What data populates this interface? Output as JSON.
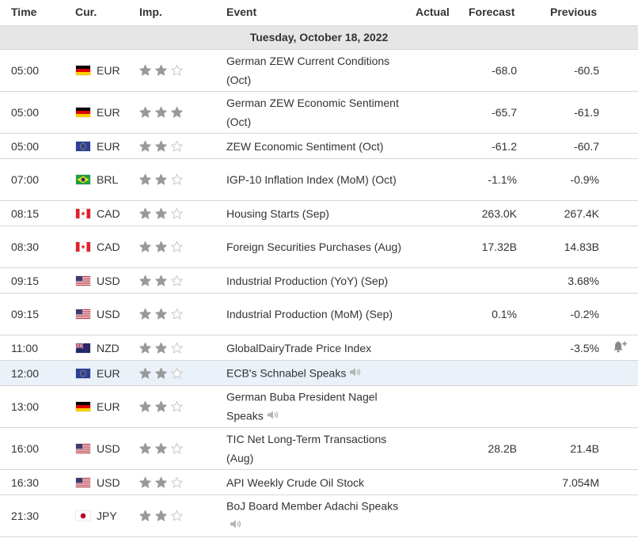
{
  "header": {
    "time": "Time",
    "currency": "Cur.",
    "importance": "Imp.",
    "event": "Event",
    "actual": "Actual",
    "forecast": "Forecast",
    "previous": "Previous"
  },
  "date_label": "Tuesday, October 18, 2022",
  "colors": {
    "star_filled": "#999999",
    "star_empty": "#cccccc",
    "border": "#d6d6d6",
    "date_row_bg": "#e6e6e6",
    "highlight_bg": "#eaf1f8"
  },
  "events": [
    {
      "time": "05:00",
      "flag": "de-flag-icon",
      "currency": "EUR",
      "stars": 2,
      "event": "German ZEW Current Conditions (Oct)",
      "speech": false,
      "actual": "",
      "forecast": "-68.0",
      "previous": "-60.5"
    },
    {
      "time": "05:00",
      "flag": "de-flag-icon",
      "currency": "EUR",
      "stars": 3,
      "event": "German ZEW Economic Sentiment (Oct)",
      "speech": false,
      "actual": "",
      "forecast": "-65.7",
      "previous": "-61.9"
    },
    {
      "time": "05:00",
      "flag": "eu-flag-icon",
      "currency": "EUR",
      "stars": 2,
      "event": "ZEW Economic Sentiment (Oct)",
      "speech": false,
      "actual": "",
      "forecast": "-61.2",
      "previous": "-60.7"
    },
    {
      "time": "07:00",
      "flag": "br-flag-icon",
      "currency": "BRL",
      "stars": 2,
      "event": "IGP-10 Inflation Index (MoM) (Oct)",
      "speech": false,
      "actual": "",
      "forecast": "-1.1%",
      "previous": "-0.9%"
    },
    {
      "time": "08:15",
      "flag": "ca-flag-icon",
      "currency": "CAD",
      "stars": 2,
      "event": "Housing Starts (Sep)",
      "speech": false,
      "actual": "",
      "forecast": "263.0K",
      "previous": "267.4K"
    },
    {
      "time": "08:30",
      "flag": "ca-flag-icon",
      "currency": "CAD",
      "stars": 2,
      "event": "Foreign Securities Purchases (Aug)",
      "speech": false,
      "actual": "",
      "forecast": "17.32B",
      "previous": "14.83B"
    },
    {
      "time": "09:15",
      "flag": "us-flag-icon",
      "currency": "USD",
      "stars": 2,
      "event": "Industrial Production (YoY) (Sep)",
      "speech": false,
      "actual": "",
      "forecast": "",
      "previous": "3.68%"
    },
    {
      "time": "09:15",
      "flag": "us-flag-icon",
      "currency": "USD",
      "stars": 2,
      "event": "Industrial Production (MoM) (Sep)",
      "speech": false,
      "actual": "",
      "forecast": "0.1%",
      "previous": "-0.2%"
    },
    {
      "time": "11:00",
      "flag": "nz-flag-icon",
      "currency": "NZD",
      "stars": 2,
      "event": "GlobalDairyTrade Price Index",
      "speech": false,
      "actual": "",
      "forecast": "",
      "previous": "-3.5%",
      "alert": true
    },
    {
      "time": "12:00",
      "flag": "eu-flag-icon",
      "currency": "EUR",
      "stars": 2,
      "event": "ECB's Schnabel Speaks",
      "speech": true,
      "actual": "",
      "forecast": "",
      "previous": "",
      "highlight": true
    },
    {
      "time": "13:00",
      "flag": "de-flag-icon",
      "currency": "EUR",
      "stars": 2,
      "event": "German Buba President Nagel Speaks",
      "speech": true,
      "actual": "",
      "forecast": "",
      "previous": ""
    },
    {
      "time": "16:00",
      "flag": "us-flag-icon",
      "currency": "USD",
      "stars": 2,
      "event": "TIC Net Long-Term Transactions (Aug)",
      "speech": false,
      "actual": "",
      "forecast": "28.2B",
      "previous": "21.4B"
    },
    {
      "time": "16:30",
      "flag": "us-flag-icon",
      "currency": "USD",
      "stars": 2,
      "event": "API Weekly Crude Oil Stock",
      "speech": false,
      "actual": "",
      "forecast": "",
      "previous": "7.054M"
    },
    {
      "time": "21:30",
      "flag": "jp-flag-icon",
      "currency": "JPY",
      "stars": 2,
      "event": "BoJ Board Member Adachi Speaks",
      "speech": true,
      "actual": "",
      "forecast": "",
      "previous": ""
    }
  ]
}
